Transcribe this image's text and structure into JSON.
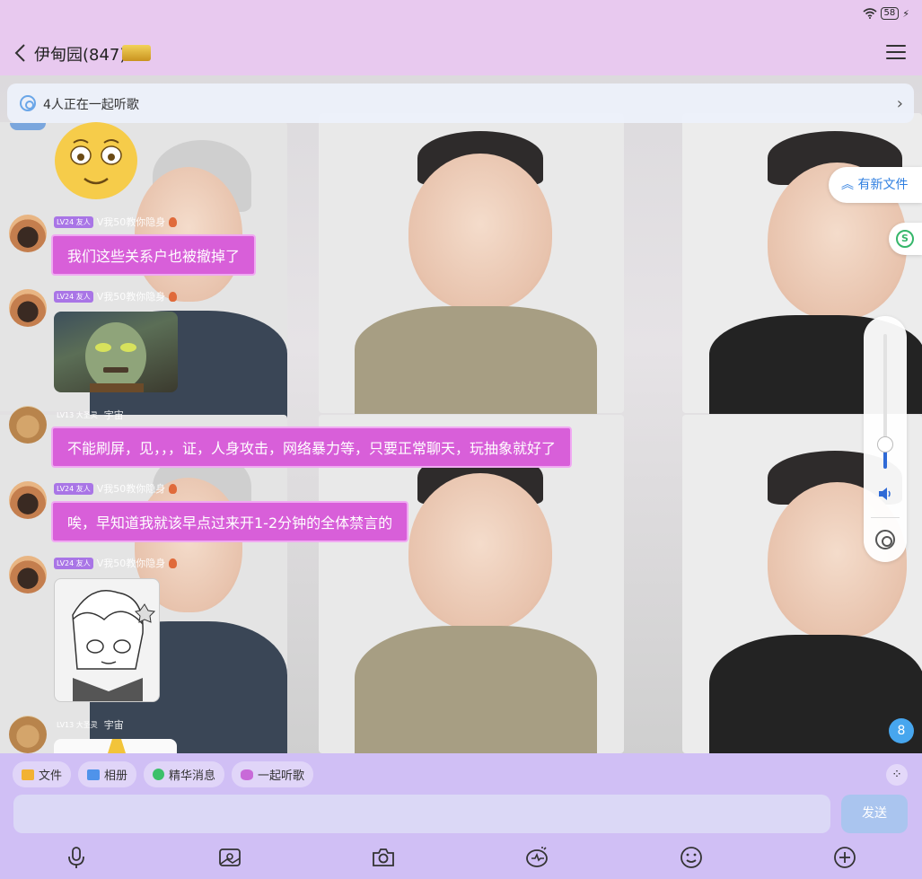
{
  "status_bar": {
    "battery": "58"
  },
  "header": {
    "title": "伊甸园(847)",
    "badge": ""
  },
  "listen_bar": {
    "text": "4人正在一起听歌"
  },
  "messages": [
    {
      "level": "LV24 友人",
      "nick": "V我50教你隐身",
      "text": "我们这些关系户也被撤掉了"
    },
    {
      "level": "LV24 友人",
      "nick": "V我50教你隐身"
    },
    {
      "level": "LV13 大圣灵",
      "nick": "宇宙",
      "text": "不能刷屏，见，，，证，人身攻击，网络暴力等，只要正常聊天，玩抽象就好了"
    },
    {
      "level": "LV24 友人",
      "nick": "V我50教你隐身",
      "text": "唉，早知道我就该早点过来开1-2分钟的全体禁言的"
    },
    {
      "level": "LV24 友人",
      "nick": "V我50教你隐身"
    },
    {
      "level": "LV13 大圣灵",
      "nick": "宇宙"
    }
  ],
  "side": {
    "new_file": "有新文件",
    "unread_count": "8",
    "volume_level": 0.18
  },
  "bottom": {
    "chips": [
      "文件",
      "相册",
      "精华消息",
      "一起听歌"
    ],
    "send": "发送"
  },
  "colors": {
    "bubble": "#d85fd9",
    "header": "#e8c9ef",
    "bottom": "#d0bff5",
    "accent": "#2f7fe0"
  }
}
